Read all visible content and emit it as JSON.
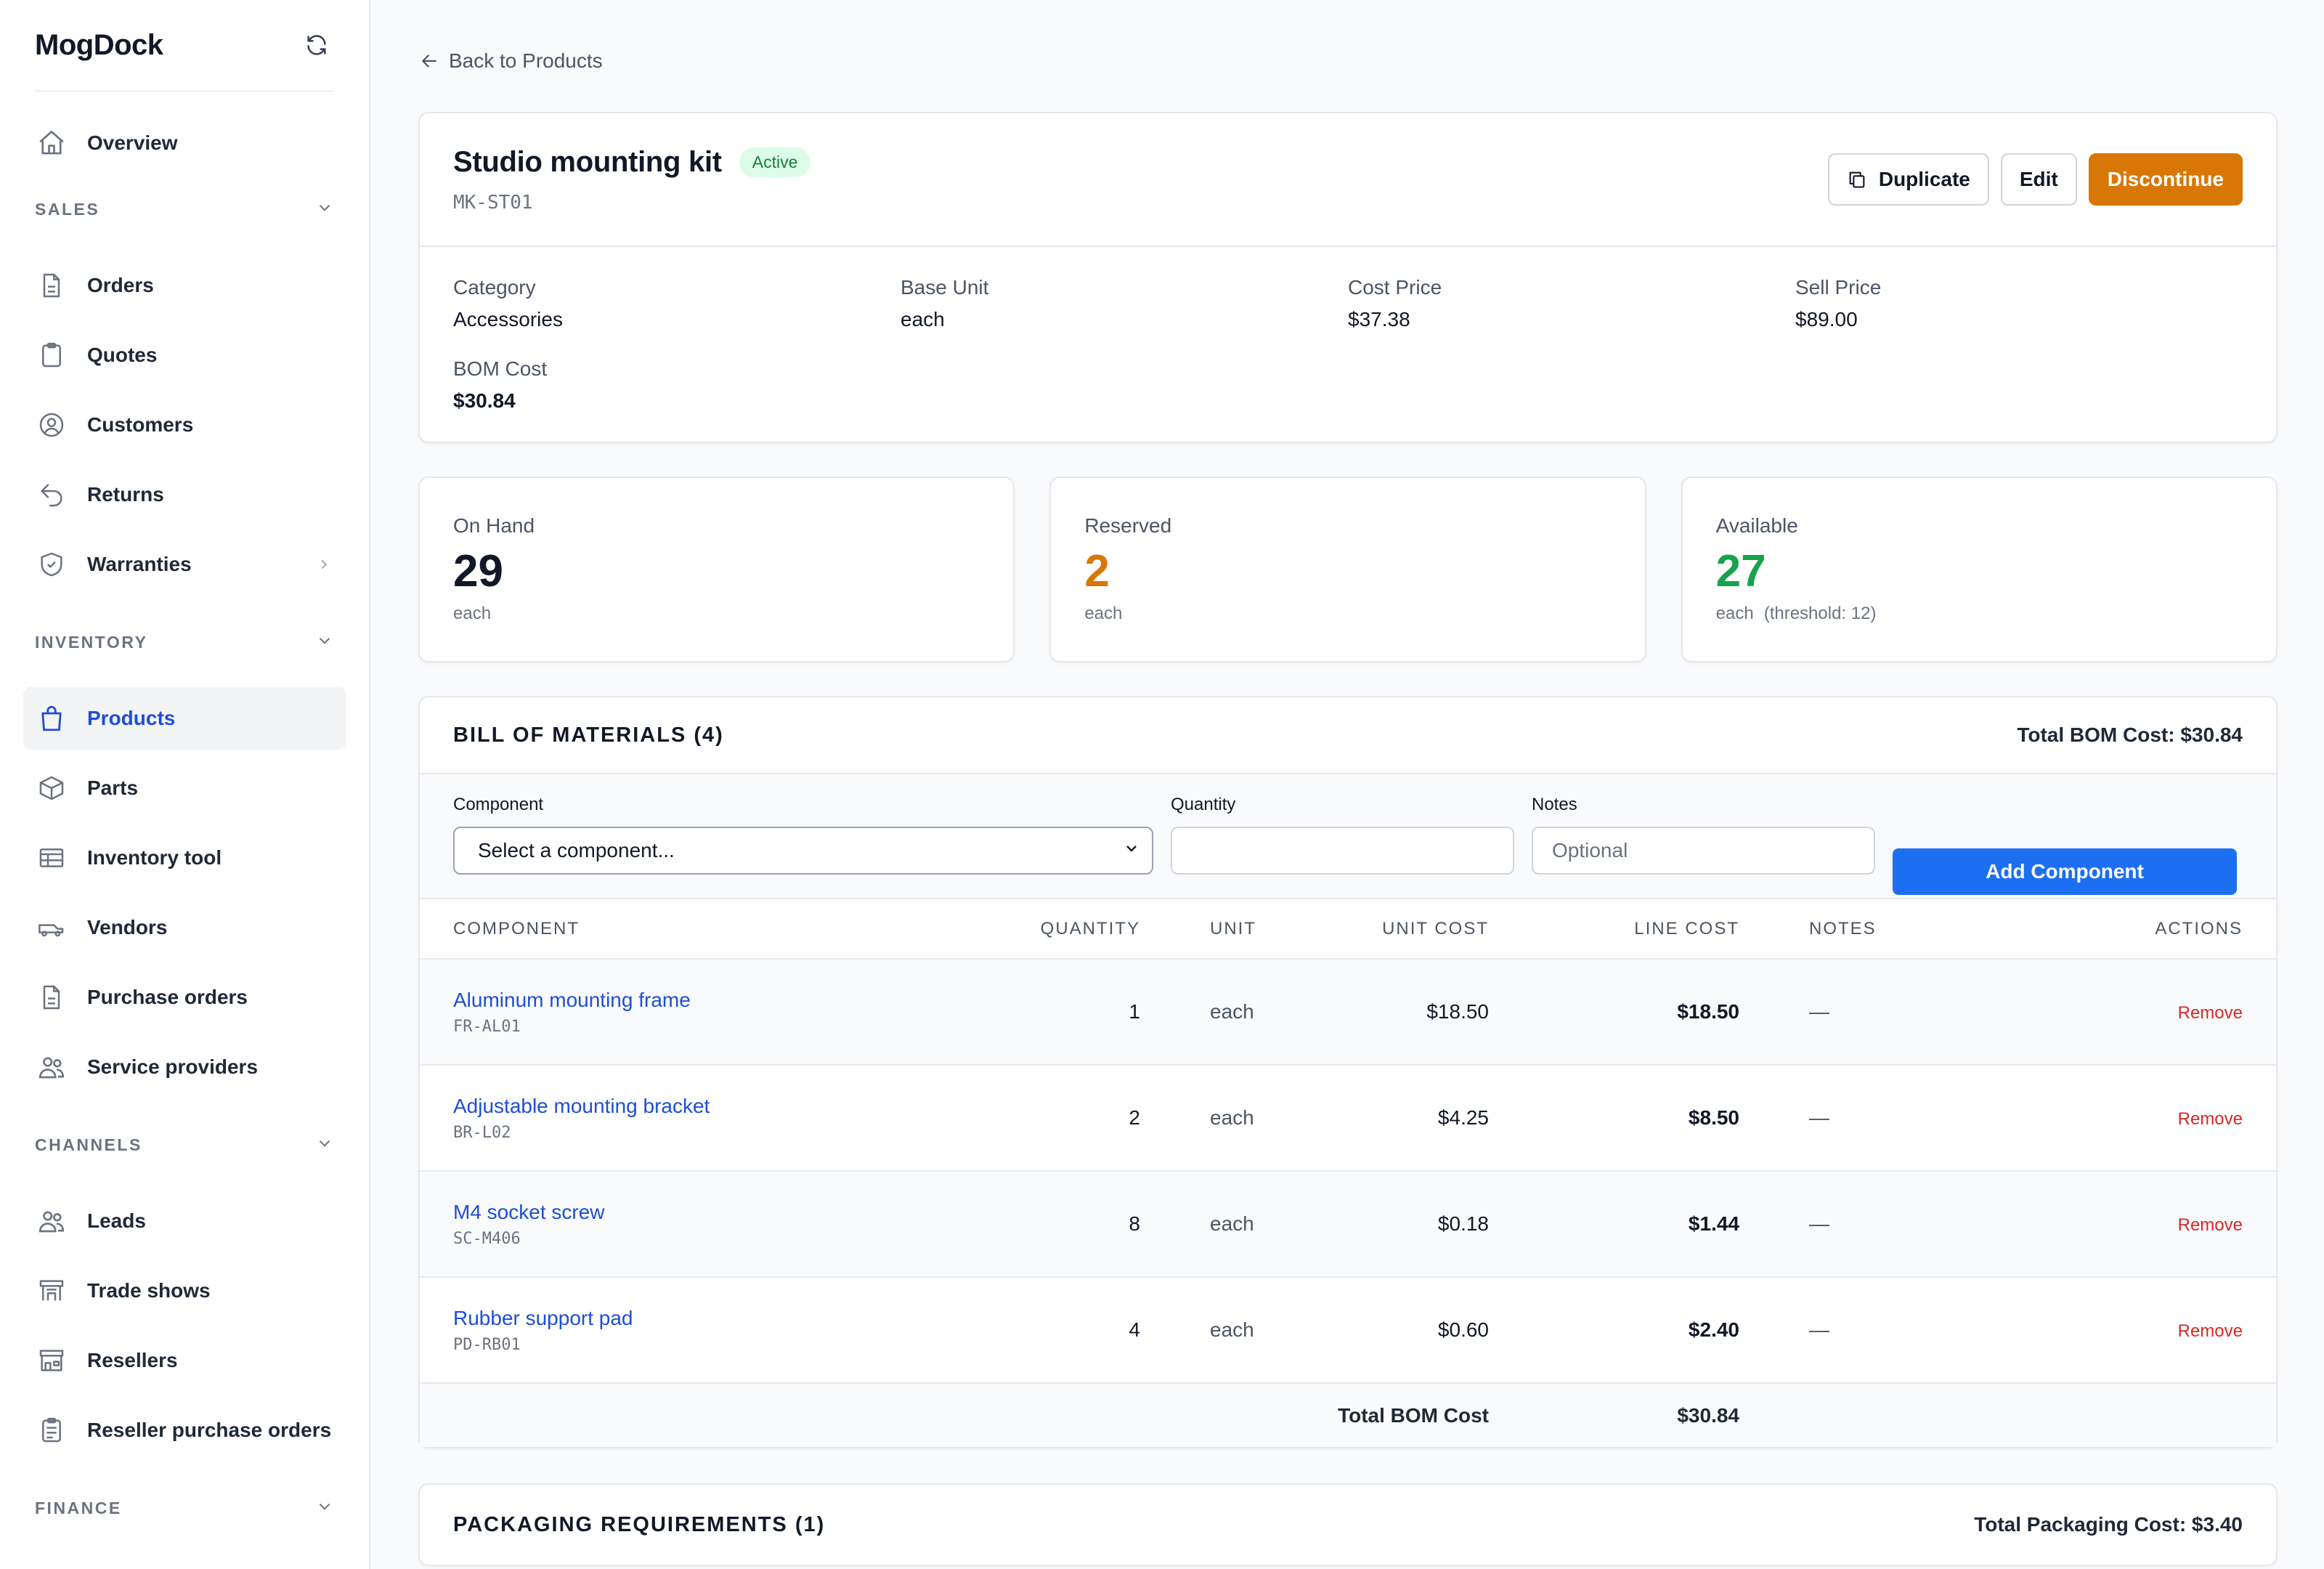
{
  "app": {
    "name": "MogDock"
  },
  "sidebar": {
    "top": [
      {
        "label": "Overview",
        "icon": "home-icon"
      }
    ],
    "sections": [
      {
        "title": "SALES",
        "items": [
          {
            "label": "Orders",
            "icon": "document-icon"
          },
          {
            "label": "Quotes",
            "icon": "clipboard-icon"
          },
          {
            "label": "Customers",
            "icon": "user-circle-icon"
          },
          {
            "label": "Returns",
            "icon": "undo-arrow-icon"
          },
          {
            "label": "Warranties",
            "icon": "shield-icon"
          }
        ]
      },
      {
        "title": "INVENTORY",
        "items": [
          {
            "label": "Products",
            "icon": "shopping-bag-icon"
          },
          {
            "label": "Parts",
            "icon": "cube-icon"
          },
          {
            "label": "Inventory tool",
            "icon": "table-icon"
          },
          {
            "label": "Vendors",
            "icon": "truck-icon"
          },
          {
            "label": "Purchase orders",
            "icon": "document-icon"
          },
          {
            "label": "Service providers",
            "icon": "users-icon"
          }
        ]
      },
      {
        "title": "CHANNELS",
        "items": [
          {
            "label": "Leads",
            "icon": "users-icon"
          },
          {
            "label": "Trade shows",
            "icon": "booth-icon"
          },
          {
            "label": "Resellers",
            "icon": "storefront-icon"
          },
          {
            "label": "Reseller purchase orders",
            "icon": "clipboard-list-icon"
          }
        ]
      },
      {
        "title": "FINANCE"
      }
    ]
  },
  "back_link": "Back to Products",
  "product": {
    "name": "Studio mounting kit",
    "status": "Active",
    "sku": "MK-ST01",
    "buttons": {
      "duplicate": "Duplicate",
      "edit": "Edit",
      "discontinue": "Discontinue"
    },
    "fields": [
      {
        "label": "Category",
        "value": "Accessories"
      },
      {
        "label": "Base Unit",
        "value": "each"
      },
      {
        "label": "Cost Price",
        "value": "$37.38"
      },
      {
        "label": "Sell Price",
        "value": "$89.00"
      },
      {
        "label": "BOM Cost",
        "value": "$30.84"
      }
    ]
  },
  "stats": [
    {
      "label": "On Hand",
      "value": "29",
      "unit": "each",
      "note": "",
      "color": "#111827"
    },
    {
      "label": "Reserved",
      "value": "2",
      "unit": "each",
      "note": "",
      "color": "#d97706"
    },
    {
      "label": "Available",
      "value": "27",
      "unit": "each",
      "note": "(threshold: 12)",
      "color": "#16a34a"
    }
  ],
  "bom": {
    "title": "BILL OF MATERIALS (4)",
    "total_label": "Total BOM Cost: $30.84",
    "form": {
      "component_label": "Component",
      "component_value": "Select a component...",
      "quantity_label": "Quantity",
      "quantity_value": "",
      "notes_label": "Notes",
      "notes_placeholder": "Optional",
      "add_button": "Add Component"
    },
    "columns": [
      "COMPONENT",
      "QUANTITY",
      "UNIT",
      "UNIT COST",
      "LINE COST",
      "NOTES",
      "ACTIONS"
    ],
    "rows": [
      {
        "name": "Aluminum mounting frame",
        "sku": "FR-AL01",
        "qty": "1",
        "unit": "each",
        "unit_cost": "$18.50",
        "line_cost": "$18.50",
        "notes": "—",
        "action": "Remove"
      },
      {
        "name": "Adjustable mounting bracket",
        "sku": "BR-L02",
        "qty": "2",
        "unit": "each",
        "unit_cost": "$4.25",
        "line_cost": "$8.50",
        "notes": "—",
        "action": "Remove"
      },
      {
        "name": "M4 socket screw",
        "sku": "SC-M406",
        "qty": "8",
        "unit": "each",
        "unit_cost": "$0.18",
        "line_cost": "$1.44",
        "notes": "—",
        "action": "Remove"
      },
      {
        "name": "Rubber support pad",
        "sku": "PD-RB01",
        "qty": "4",
        "unit": "each",
        "unit_cost": "$0.60",
        "line_cost": "$2.40",
        "notes": "—",
        "action": "Remove"
      }
    ],
    "footer_label": "Total BOM Cost",
    "footer_value": "$30.84"
  },
  "packaging": {
    "title": "PACKAGING REQUIREMENTS (1)",
    "total_label": "Total Packaging Cost: $3.40"
  }
}
